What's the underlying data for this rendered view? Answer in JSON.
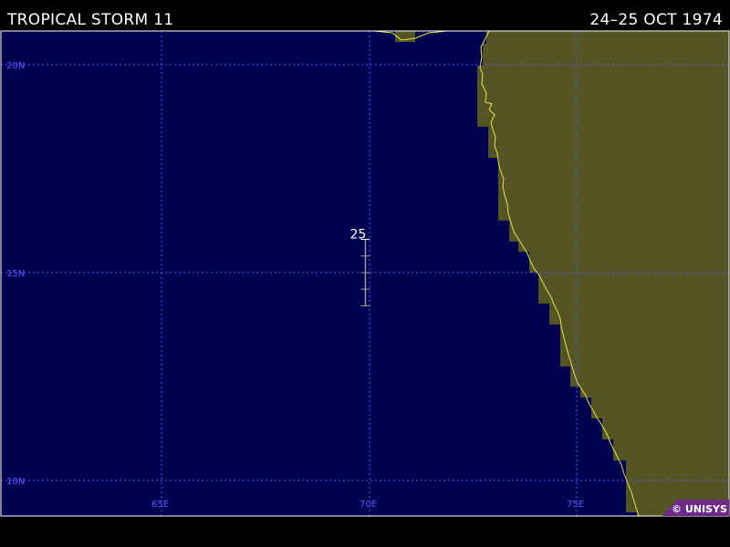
{
  "header": {
    "title": "TROPICAL STORM 11",
    "dates": "24–25 OCT 1974"
  },
  "map": {
    "lat_labels": [
      "20N",
      "15N",
      "10N"
    ],
    "lon_labels": [
      "65E",
      "70E",
      "75E"
    ],
    "colors": {
      "ocean": "#000050",
      "land": "#545424",
      "coast": "#e5e54a",
      "grid": "#5a5aff",
      "track": "#9a9a9a",
      "frame": "#ffffff",
      "credit_bg": "#6f2a8a"
    }
  },
  "track": {
    "points": [
      {
        "lat": 15.8,
        "lon": 69.9,
        "wind_label": "25"
      },
      {
        "lat": 15.4,
        "lon": 69.9
      },
      {
        "lat": 15.0,
        "lon": 69.9
      },
      {
        "lat": 14.6,
        "lon": 69.9
      },
      {
        "lat": 14.2,
        "lon": 69.9
      }
    ]
  },
  "credit": "© UNISYS"
}
